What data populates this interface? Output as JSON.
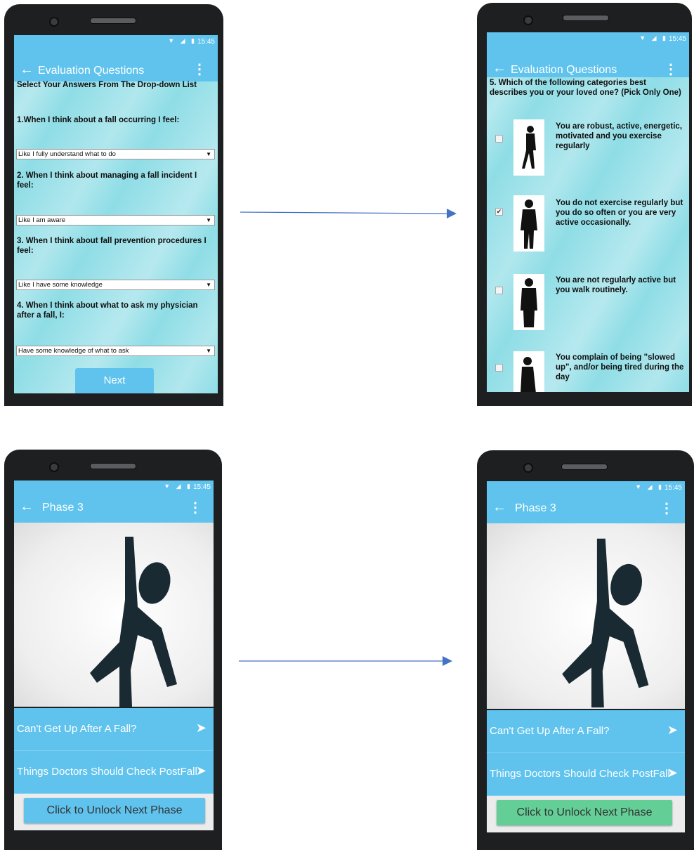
{
  "status_time": "15:45",
  "status_icons": "▼ ◢ ▮",
  "back_glyph": "←",
  "menu_glyph": "⋮",
  "screen1": {
    "title": "Evaluation Questions",
    "instruction": "Select Your Answers From The Drop-down List",
    "questions": [
      {
        "text": "1.When I think about a fall occurring I feel:",
        "answer": "Like I fully understand what to do"
      },
      {
        "text": "2. When I think about managing a fall incident I feel:",
        "answer": "Like I am aware"
      },
      {
        "text": "3. When I think about fall prevention procedures I feel:",
        "answer": "Like I have some knowledge"
      },
      {
        "text": "4. When I think about what to ask my physician after a fall, I:",
        "answer": "Have some knowledge of what to ask"
      }
    ],
    "next_label": "Next"
  },
  "screen2": {
    "title": "Evaluation Questions",
    "question": "5. Which of the following categories best describes you or your loved one? (Pick Only One)",
    "options": [
      {
        "text": "You are robust, active, energetic, motivated and you exercise regularly",
        "checked": false
      },
      {
        "text": "You do not exercise regularly but you do so often or you are very active occasionally.",
        "checked": true
      },
      {
        "text": "You are not regularly active but you walk routinely.",
        "checked": false
      },
      {
        "text": "You complain of being \"slowed up\", and/or being tired during the day",
        "checked": false
      }
    ]
  },
  "screen3": {
    "title": "Phase 3",
    "rows": [
      "Can't Get Up After A Fall?",
      "Things Doctors Should Check PostFall"
    ],
    "unlock_label": "Click to Unlock Next Phase",
    "unlock_color": "#5fc3ee"
  },
  "screen4": {
    "title": "Phase 3",
    "rows": [
      "Can't Get Up After A Fall?",
      "Things Doctors Should Check PostFall"
    ],
    "unlock_label": "Click to Unlock Next Phase",
    "unlock_color": "#63cf97"
  },
  "colors": {
    "appbar": "#5fc3ee",
    "arrow": "#4472c4",
    "bezel": "#1e1f21"
  }
}
